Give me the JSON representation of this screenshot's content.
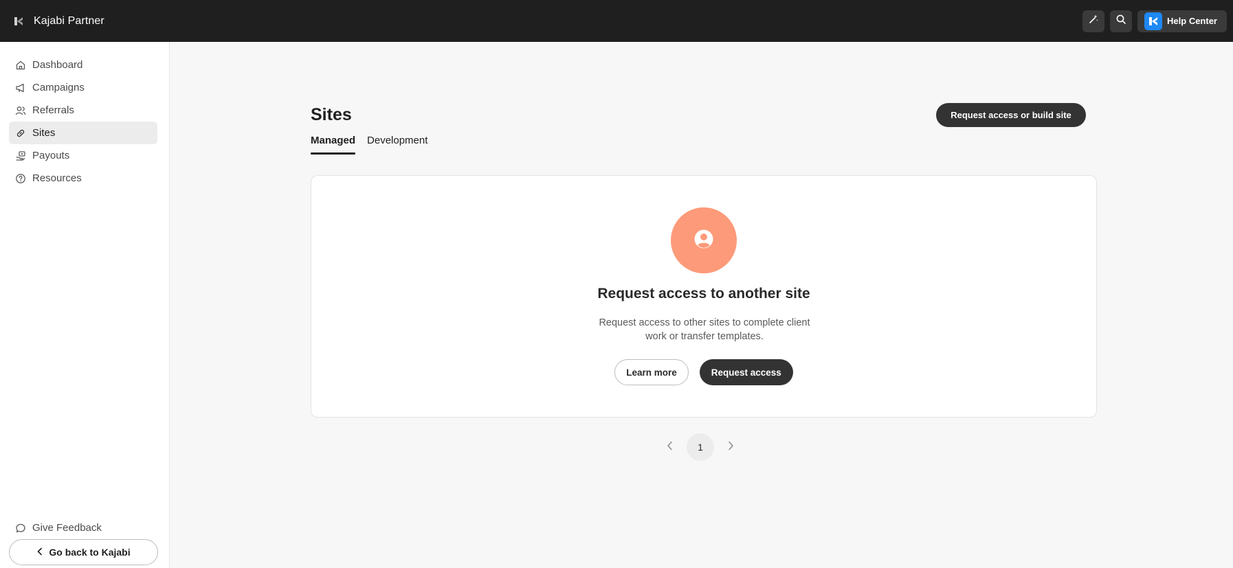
{
  "header": {
    "brand": "Kajabi Partner",
    "help_label": "Help Center",
    "icons": [
      "magic-wand-icon",
      "search-icon",
      "kajabi-logo-icon"
    ]
  },
  "sidebar": {
    "items": [
      {
        "label": "Dashboard",
        "icon": "home-icon"
      },
      {
        "label": "Campaigns",
        "icon": "megaphone-icon"
      },
      {
        "label": "Referrals",
        "icon": "users-icon"
      },
      {
        "label": "Sites",
        "icon": "link-icon",
        "active": true
      },
      {
        "label": "Payouts",
        "icon": "payout-icon"
      },
      {
        "label": "Resources",
        "icon": "question-circle-icon"
      }
    ],
    "feedback_label": "Give Feedback",
    "go_back_label": "Go back to Kajabi"
  },
  "main": {
    "title": "Sites",
    "primary_action": "Request access or build site",
    "tabs": [
      {
        "label": "Managed",
        "active": true
      },
      {
        "label": "Development"
      }
    ],
    "empty_state": {
      "title": "Request access to another site",
      "description": "Request access to other sites to complete client work or transfer templates.",
      "learn_more": "Learn more",
      "request_access": "Request access",
      "accent": "#fd9a79"
    },
    "pagination": {
      "current_page": "1"
    }
  }
}
